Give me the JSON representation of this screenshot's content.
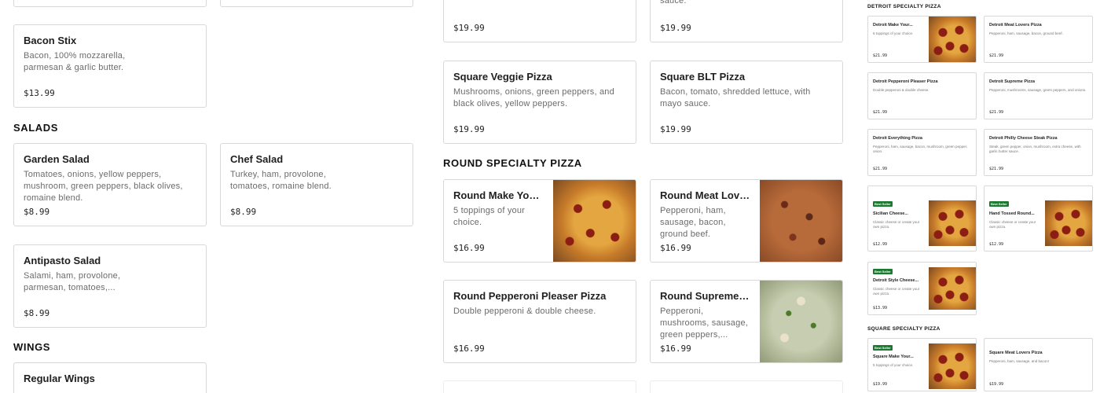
{
  "left": {
    "bacon_stix": {
      "name": "Bacon Stix",
      "desc": "Bacon, 100% mozzarella, parmesan & garlic butter.",
      "price": "$13.99"
    },
    "salads": {
      "heading": "SALADS",
      "items": [
        {
          "name": "Garden Salad",
          "desc": "Tomatoes, onions, yellow peppers, mushroom, green peppers, black olives, romaine blend.",
          "price": "$8.99"
        },
        {
          "name": "Chef Salad",
          "desc": "Turkey, ham, provolone, tomatoes, romaine blend.",
          "price": "$8.99"
        },
        {
          "name": "Antipasto Salad",
          "desc": "Salami, ham, provolone, parmesan, tomatoes,...",
          "price": "$8.99"
        }
      ]
    },
    "wings": {
      "heading": "WINGS",
      "items": [
        {
          "name": "Regular Wings"
        }
      ]
    }
  },
  "middle": {
    "square_top": [
      {
        "price": "$19.99"
      },
      {
        "desc": "sauce.",
        "price": "$19.99"
      }
    ],
    "square_row2": [
      {
        "name": "Square Veggie Pizza",
        "desc": "Mushrooms, onions, green peppers, and black olives, yellow peppers.",
        "price": "$19.99"
      },
      {
        "name": "Square BLT Pizza",
        "desc": "Bacon, tomato, shredded lettuce, with mayo sauce.",
        "price": "$19.99"
      }
    ],
    "round": {
      "heading": "ROUND SPECIALTY PIZZA",
      "items": [
        {
          "name": "Round Make Your Own Pizza",
          "desc": "5 toppings of your choice.",
          "price": "$16.99",
          "image": "pepperoni-pizza"
        },
        {
          "name": "Round Meat Lovers Pizza",
          "desc": "Pepperoni, ham, sausage, bacon, ground beef.",
          "price": "$16.99",
          "image": "meat-pizza"
        },
        {
          "name": "Round Pepperoni Pleaser Pizza",
          "desc": "Double pepperoni & double cheese.",
          "price": "$16.99"
        },
        {
          "name": "Round Supreme Pizza",
          "desc": "Pepperoni, mushrooms, sausage, green peppers,...",
          "price": "$16.99",
          "image": "supreme-pizza"
        }
      ]
    }
  },
  "right": {
    "detroit": {
      "heading": "DETROIT SPECIALTY PIZZA",
      "items": [
        {
          "name": "Detroit Make Your...",
          "desc": "5 toppings of your choice.",
          "price": "$21.99"
        },
        {
          "name": "Detroit Meat Lovers Pizza",
          "desc": "Pepperoni, ham, sausage, bacon, ground beef.",
          "price": "$21.99"
        },
        {
          "name": "Detroit Pepperoni Pleaser Pizza",
          "desc": "Double pepperoni & double cheese.",
          "price": "$21.99"
        },
        {
          "name": "Detroit Supreme Pizza",
          "desc": "Pepperoni, mushrooms, sausage, green peppers, and onions.",
          "price": "$21.99"
        },
        {
          "name": "Detroit Everything Pizza",
          "desc": "Pepperoni, ham, sausage, bacon, mushroom, green pepper, onion.",
          "price": "$21.99"
        },
        {
          "name": "Detroit Philly Cheese Steak Pizza",
          "desc": "Steak, green pepper, onion, mushroom, extra cheese, with garlic butter sauce.",
          "price": "$21.99"
        }
      ],
      "popup": {
        "badge": "Best Seller",
        "items": [
          {
            "name": "Sicilian Cheese...",
            "desc": "Classic cheese or create your own pizza.",
            "price": "$12.99"
          },
          {
            "name": "Hand Tossed Round...",
            "desc": "Classic cheese or create your own pizza.",
            "price": "$12.99"
          },
          {
            "name": "Detroit Style Cheese...",
            "desc": "Classic cheese or create your own pizza.",
            "price": "$13.99"
          }
        ]
      }
    },
    "square": {
      "heading": "SQUARE SPECIALTY PIZZA",
      "items": [
        {
          "badge": "Best Seller",
          "name": "Square Make Your...",
          "desc": "5 toppings of your choice.",
          "price": "$19.99"
        },
        {
          "name": "Square Meat Lovers Pizza",
          "desc": "Pepperoni, ham, sausage, and bacon!",
          "price": "$19.99"
        }
      ]
    }
  }
}
